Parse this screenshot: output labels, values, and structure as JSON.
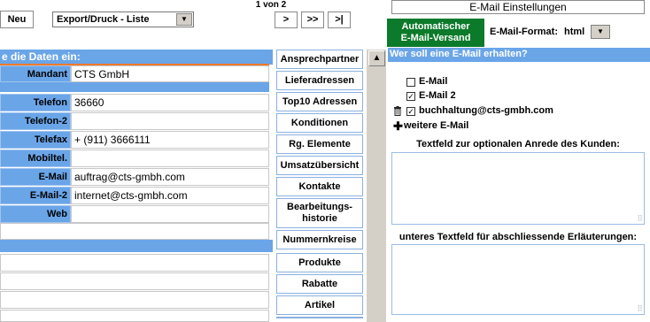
{
  "toolbar": {
    "new_label": "Neu",
    "view_select": "Export/Druck - Liste",
    "page_indicator": "1 von 2",
    "next": ">",
    "last_jump": ">>",
    "end": ">|"
  },
  "form": {
    "header": "e die Daten ein:",
    "fields": [
      {
        "label": "Mandant",
        "value": "CTS GmbH"
      },
      {
        "label": "Telefon",
        "value": "36660"
      },
      {
        "label": "Telefon-2",
        "value": ""
      },
      {
        "label": "Telefax",
        "value": "+ (911) 3666111"
      },
      {
        "label": "Mobiltel.",
        "value": ""
      },
      {
        "label": "E-Mail",
        "value": "auftrag@cts-gmbh.com"
      },
      {
        "label": "E-Mail-2",
        "value": "internet@cts-gmbh.com"
      },
      {
        "label": "Web",
        "value": ""
      }
    ]
  },
  "tabs": [
    "Ansprechpartner",
    "Lieferadressen",
    "Top10 Adressen",
    "Konditionen",
    "Rg. Elemente",
    "Umsatzübersicht",
    "Kontakte",
    "Bearbeitungs-historie",
    "Nummernkreise",
    "Produkte",
    "Rabatte",
    "Artikel"
  ],
  "email_panel": {
    "title": "E-Mail Einstellungen",
    "auto_button_line1": "Automatischer",
    "auto_button_line2": "E-Mail-Versand",
    "format_label": "E-Mail-Format:",
    "format_value": "html",
    "question": "Wer soll eine E-Mail erhalten?",
    "recipients": [
      {
        "label": "E-Mail",
        "checked": false
      },
      {
        "label": "E-Mail 2",
        "checked": true
      },
      {
        "label": "buchhaltung@cts-gmbh.com",
        "checked": true
      }
    ],
    "add_more": "weitere E-Mail",
    "salutation_label": "Textfeld zur optionalen Anrede des Kunden:",
    "footer_label": "unteres Textfeld für abschliessende Erläuterungen:"
  },
  "icons": {
    "scroll_up": "up-arrow-icon",
    "dropdown": "chevron-down-icon",
    "trash": "trash-icon",
    "plus": "plus-icon"
  },
  "colors": {
    "accent_blue": "#6aa5e8",
    "green_button": "#0b7a2a",
    "orange_line": "#f07a2a"
  }
}
